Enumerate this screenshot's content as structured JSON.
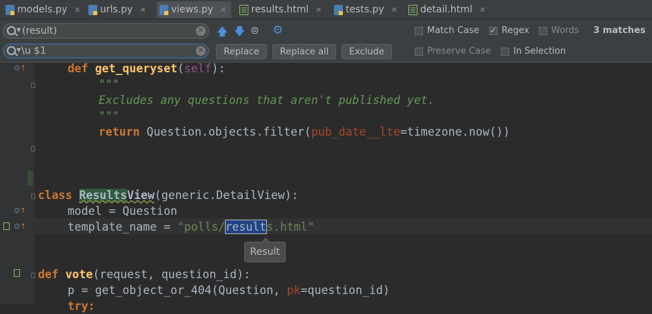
{
  "tabs": [
    {
      "label": "models.py",
      "icon": "python-file-icon",
      "active": false
    },
    {
      "label": "urls.py",
      "icon": "python-file-icon",
      "active": false
    },
    {
      "label": "views.py",
      "icon": "python-file-icon",
      "active": true
    },
    {
      "label": "results.html",
      "icon": "html-file-icon",
      "active": false
    },
    {
      "label": "tests.py",
      "icon": "python-file-icon",
      "active": false
    },
    {
      "label": "detail.html",
      "icon": "html-file-icon",
      "active": false
    }
  ],
  "find": {
    "search_value": "(result)",
    "replace_value": "\\u $1",
    "replace_label": "Replace",
    "replace_all_label": "Replace all",
    "exclude_label": "Exclude",
    "match_case_label": "Match Case",
    "regex_label": "Regex",
    "words_label": "Words",
    "preserve_case_label": "Preserve Case",
    "in_selection_label": "In Selection",
    "matches": "3 matches",
    "regex_checked": true,
    "match_case_checked": false,
    "words_checked": false,
    "preserve_case_checked": false,
    "in_selection_checked": false
  },
  "code": {
    "l1_kw": "def",
    "l1_fn": "get_queryset",
    "l1_self": "self",
    "l2": "\"\"\"",
    "l3": "Excludes any questions that aren't published yet.",
    "l4": "\"\"\"",
    "l5_kw": "return",
    "l5_a": "Question.objects.filter(",
    "l5_param": "pub_date__lte",
    "l5_b": "=timezone.now())",
    "l8_kw": "class",
    "l8_hl": "Results",
    "l8_rest": "View",
    "l8_tail": "(generic.DetailView):",
    "l9": "model = Question",
    "l10_a": "template_name = ",
    "l10_s1": "\"polls/",
    "l10_sel": "result",
    "l10_s2": "s.html\"",
    "l13_kw": "def",
    "l13_fn": "vote",
    "l13_rest": "(request, question_id):",
    "l14_a": "p = get_object_or_404(Question, ",
    "l14_param": "pk",
    "l14_b": "=question_id)",
    "l15_kw": "try:"
  },
  "tooltip": "Result"
}
